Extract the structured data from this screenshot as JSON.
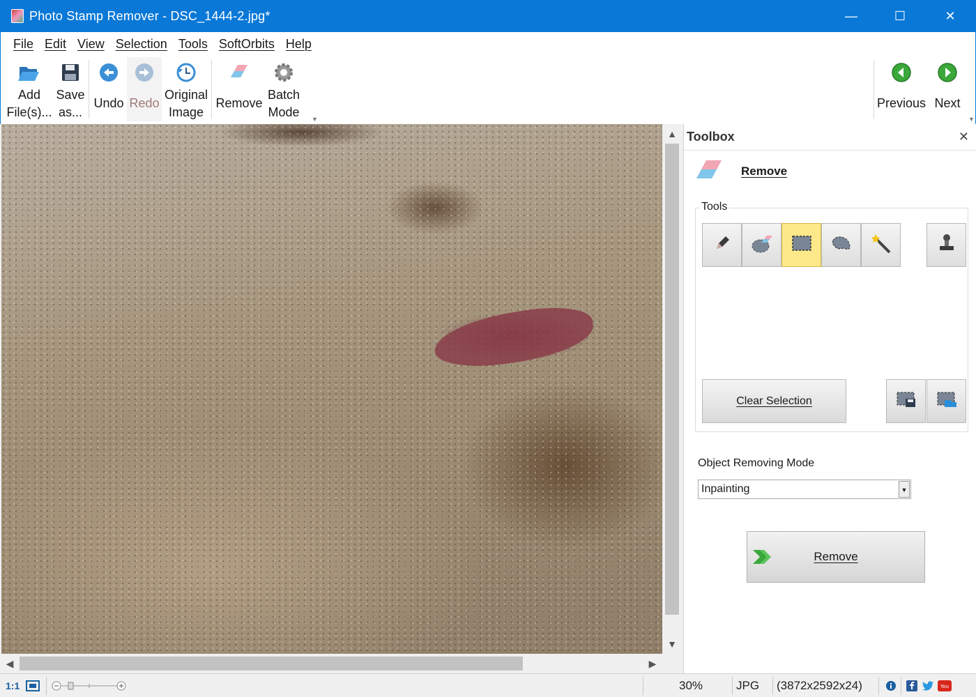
{
  "window": {
    "title": "Photo Stamp Remover - DSC_1444-2.jpg*",
    "controls": {
      "minimize": "—",
      "maximize": "☐",
      "close": "✕"
    }
  },
  "menu": [
    "File",
    "Edit",
    "View",
    "Selection",
    "Tools",
    "SoftOrbits",
    "Help"
  ],
  "toolbar": {
    "add_files": [
      "Add",
      "File(s)..."
    ],
    "save_as": [
      "Save",
      "as..."
    ],
    "undo": "Undo",
    "redo": "Redo",
    "original_image": [
      "Original",
      "Image"
    ],
    "remove": "Remove",
    "batch_mode": [
      "Batch",
      "Mode"
    ],
    "previous": "Previous",
    "next": "Next"
  },
  "toolbox": {
    "header": "Toolbox",
    "section": "Remove",
    "tools_label": "Tools",
    "tools": [
      "pencil-icon",
      "eraser-icon",
      "rectangle-select-icon",
      "lasso-icon",
      "magic-wand-icon",
      "stamp-icon"
    ],
    "active_tool": "rectangle-select-icon",
    "clear_selection": "Clear Selection",
    "mode_label": "Object Removing Mode",
    "mode_value": "Inpainting",
    "remove_button": "Remove"
  },
  "status": {
    "zoom_reset": "1:1",
    "zoom_percent": "30%",
    "format": "JPG",
    "dimensions": "(3872x2592x24)"
  },
  "colors": {
    "titlebar": "#0a78d7",
    "active_tool": "#fde989",
    "nav_arrow": "#3aa83a"
  }
}
